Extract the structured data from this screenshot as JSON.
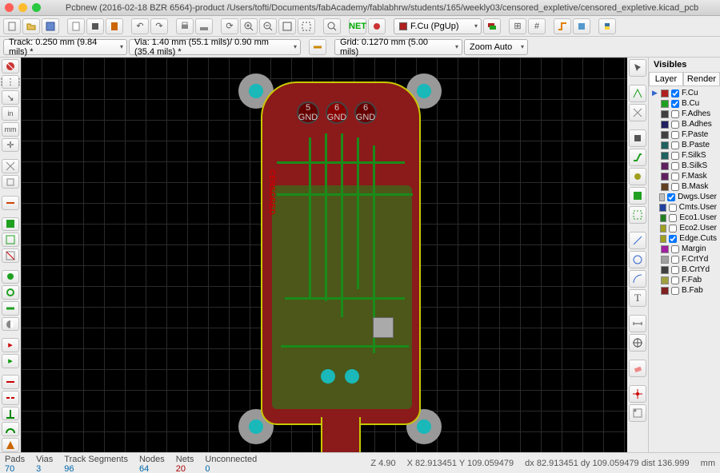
{
  "window": {
    "title": "Pcbnew (2016-02-18 BZR 6564)-product /Users/tofti/Documents/fabAcademy/fablabhrw/students/165/weekly03/censored_expletive/censored_expletive.kicad_pcb"
  },
  "toolbar": {
    "layer_selector": "F.Cu (PgUp)"
  },
  "options": {
    "track": "Track: 0.250 mm (9.84 mils) *",
    "via": "Via: 1.40 mm (55.1 mils)/ 0.90 mm (35.4 mils) *",
    "grid": "Grid: 0.1270 mm (5.00 mils)",
    "zoom": "Zoom Auto"
  },
  "board": {
    "pads": [
      {
        "num": "5",
        "net": "GND"
      },
      {
        "num": "6",
        "net": "GND"
      },
      {
        "num": "6",
        "net": "GND"
      }
    ],
    "silktext": "CENSORED"
  },
  "visibles": {
    "title": "Visibles",
    "tabs": {
      "layer": "Layer",
      "render": "Render"
    },
    "layers": [
      {
        "name": "F.Cu",
        "color": "#b02020",
        "checked": true,
        "active": true
      },
      {
        "name": "B.Cu",
        "color": "#20a020",
        "checked": true,
        "active": false
      },
      {
        "name": "F.Adhes",
        "color": "#404040",
        "checked": false,
        "active": false
      },
      {
        "name": "B.Adhes",
        "color": "#202060",
        "checked": false,
        "active": false
      },
      {
        "name": "F.Paste",
        "color": "#404040",
        "checked": false,
        "active": false
      },
      {
        "name": "B.Paste",
        "color": "#206060",
        "checked": false,
        "active": false
      },
      {
        "name": "F.SilkS",
        "color": "#206060",
        "checked": false,
        "active": false
      },
      {
        "name": "B.SilkS",
        "color": "#602060",
        "checked": false,
        "active": false
      },
      {
        "name": "F.Mask",
        "color": "#602060",
        "checked": false,
        "active": false
      },
      {
        "name": "B.Mask",
        "color": "#604020",
        "checked": false,
        "active": false
      },
      {
        "name": "Dwgs.User",
        "color": "#c0c0c0",
        "checked": true,
        "active": false
      },
      {
        "name": "Cmts.User",
        "color": "#2040a0",
        "checked": false,
        "active": false
      },
      {
        "name": "Eco1.User",
        "color": "#208020",
        "checked": false,
        "active": false
      },
      {
        "name": "Eco2.User",
        "color": "#a0a020",
        "checked": false,
        "active": false
      },
      {
        "name": "Edge.Cuts",
        "color": "#a0a020",
        "checked": true,
        "active": false
      },
      {
        "name": "Margin",
        "color": "#a020a0",
        "checked": false,
        "active": false
      },
      {
        "name": "F.CrtYd",
        "color": "#a0a0a0",
        "checked": false,
        "active": false
      },
      {
        "name": "B.CrtYd",
        "color": "#404040",
        "checked": false,
        "active": false
      },
      {
        "name": "F.Fab",
        "color": "#a0a040",
        "checked": false,
        "active": false
      },
      {
        "name": "B.Fab",
        "color": "#802020",
        "checked": false,
        "active": false
      }
    ]
  },
  "status": {
    "pads": {
      "label": "Pads",
      "value": "70"
    },
    "vias": {
      "label": "Vias",
      "value": "3"
    },
    "tracks": {
      "label": "Track Segments",
      "value": "96"
    },
    "nodes": {
      "label": "Nodes",
      "value": "64"
    },
    "nets": {
      "label": "Nets",
      "value": "20"
    },
    "unconn": {
      "label": "Unconnected",
      "value": "0"
    },
    "zoom": "Z 4.90",
    "abs": "X 82.913451  Y 109.059479",
    "rel": "dx 82.913451  dy 109.059479  dist 136.999",
    "unit": "mm"
  }
}
